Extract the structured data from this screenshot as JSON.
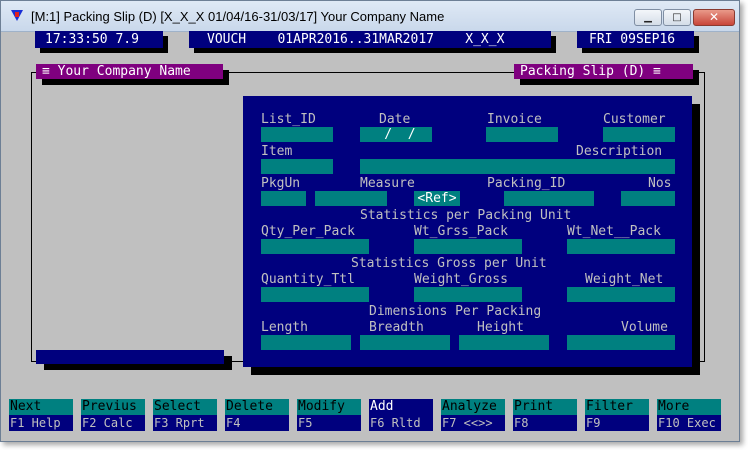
{
  "window": {
    "title": "[M:1]  Packing Slip (D)  [X_X_X  01/04/16-31/03/17]  Your Company Name",
    "minimize_glyph": "▁",
    "maximize_glyph": "□",
    "close_glyph": "✕"
  },
  "status_bar": {
    "time_version": "17:33:50 7.9",
    "vouch": "VOUCH    01APR2016..31MAR2017    X_X_X",
    "date": "FRI 09SEP16"
  },
  "headers": {
    "company": "≡ Your Company Name",
    "form": "Packing Slip (D) ≡"
  },
  "form": {
    "labels": {
      "list_id": "List_ID",
      "date": "Date",
      "invoice": "Invoice",
      "customer": "Customer",
      "item": "Item",
      "description": "Description",
      "pkgun": "PkgUn",
      "measure": "Measure",
      "packing_id": "Packing_ID",
      "nos": "Nos",
      "stats_per_pack": "Statistics per Packing Unit",
      "qty_per_pack": "Qty_Per_Pack",
      "wt_grss_pack": "Wt_Grss_Pack",
      "wt_net_pack": "Wt_Net__Pack",
      "stats_gross": "Statistics Gross per Unit",
      "quantity_ttl": "Quantity_Ttl",
      "weight_gross": "Weight_Gross",
      "weight_net": "Weight_Net",
      "dimensions": "Dimensions Per Packing",
      "length": "Length",
      "breadth": "Breadth",
      "height": "Height",
      "volume": "Volume"
    },
    "values": {
      "date": " /  /",
      "measure_ref": "<Ref>"
    }
  },
  "function_keys": [
    {
      "top": "Next",
      "bottom": "F1 Help"
    },
    {
      "top": "Previus",
      "bottom": "F2 Calc"
    },
    {
      "top": "Select",
      "bottom": "F3 Rprt"
    },
    {
      "top": "Delete",
      "bottom": "F4"
    },
    {
      "top": "Modify",
      "bottom": "F5"
    },
    {
      "top": "Add",
      "bottom": "F6 Rltd"
    },
    {
      "top": "Analyze",
      "bottom": "F7 <<>>"
    },
    {
      "top": "Print",
      "bottom": "F8"
    },
    {
      "top": "Filter",
      "bottom": "F9"
    },
    {
      "top": "More",
      "bottom": "F10 Exec"
    }
  ],
  "colors": {
    "panel_navy": "#00007e",
    "field_teal": "#008080",
    "header_magenta": "#7f007f",
    "background_gray": "#c0c0c0"
  }
}
